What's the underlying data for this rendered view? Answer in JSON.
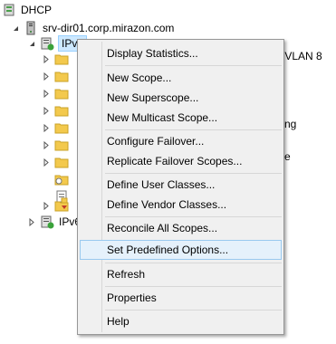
{
  "tree": {
    "root_label": "DHCP",
    "server_label": "srv-dir01.corp.mirazon.com",
    "ipv4_label": "IPv4",
    "ipv6_label": "IPv6",
    "behind_texts": [
      "rk VLAN 8",
      "ng",
      "e"
    ]
  },
  "context_menu": {
    "items": [
      "Display Statistics...",
      "New Scope...",
      "New Superscope...",
      "New Multicast Scope...",
      "Configure Failover...",
      "Replicate Failover Scopes...",
      "Define User Classes...",
      "Define Vendor Classes...",
      "Reconcile All Scopes...",
      "Set Predefined Options...",
      "Refresh",
      "Properties",
      "Help"
    ],
    "highlighted_index": 9
  },
  "colors": {
    "selection": "#cce8ff",
    "menu_background": "#f0f0f0",
    "menu_highlight": "#e5f1fb",
    "folder": "#f3c94d"
  }
}
